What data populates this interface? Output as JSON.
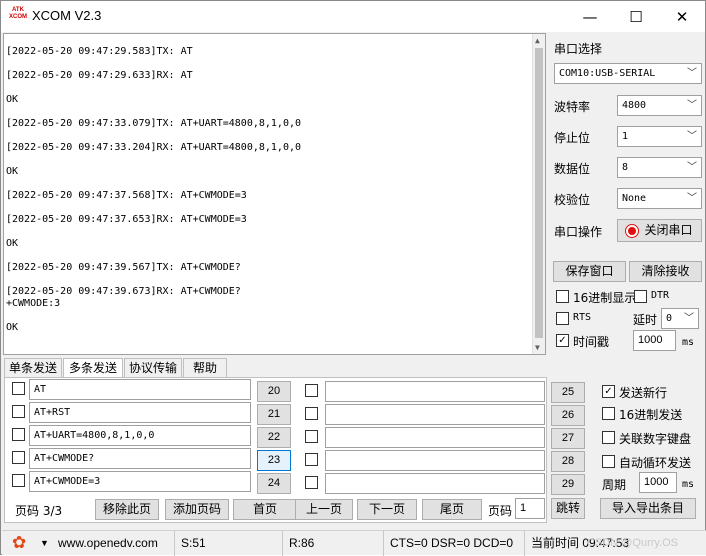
{
  "window": {
    "title": "XCOM V2.3",
    "logo_text": "ATK XCOM",
    "minimize": "—",
    "maximize": "☐",
    "close": "✕"
  },
  "receive": {
    "lines": [
      "[2022-05-20 09:47:29.583]TX: AT",
      "[2022-05-20 09:47:29.633]RX: AT",
      "OK",
      "[2022-05-20 09:47:33.079]TX: AT+UART=4800,8,1,0,0",
      "[2022-05-20 09:47:33.204]RX: AT+UART=4800,8,1,0,0",
      "OK",
      "[2022-05-20 09:47:37.568]TX: AT+CWMODE=3",
      "[2022-05-20 09:47:37.653]RX: AT+CWMODE=3",
      "OK",
      "[2022-05-20 09:47:39.567]TX: AT+CWMODE?",
      "[2022-05-20 09:47:39.673]RX: AT+CWMODE?",
      "+CWMODE:3",
      "OK"
    ]
  },
  "serial": {
    "port_label": "串口选择",
    "port_value": "COM10:USB-SERIAL",
    "baud_label": "波特率",
    "baud_value": "4800",
    "stop_label": "停止位",
    "stop_value": "1",
    "data_label": "数据位",
    "data_value": "8",
    "parity_label": "校验位",
    "parity_value": "None",
    "op_label": "串口操作",
    "op_button": "关闭串口"
  },
  "controls": {
    "save_window": "保存窗口",
    "clear_recv": "清除接收",
    "hex_display": "16进制显示",
    "dtr": "DTR",
    "rts": "RTS",
    "delay_label": "延时",
    "delay_value": "0",
    "timestamp": "时间戳",
    "timestamp_value": "1000",
    "unit_ms": "ms"
  },
  "tabs": [
    "单条发送",
    "多条发送",
    "协议传输",
    "帮助"
  ],
  "multi_send": {
    "left": [
      {
        "text": "AT",
        "num": "20"
      },
      {
        "text": "AT+RST",
        "num": "21"
      },
      {
        "text": "AT+UART=4800,8,1,0,0",
        "num": "22"
      },
      {
        "text": "AT+CWMODE?",
        "num": "23"
      },
      {
        "text": "AT+CWMODE=3",
        "num": "24"
      }
    ],
    "right": [
      {
        "text": "",
        "num": "25"
      },
      {
        "text": "",
        "num": "26"
      },
      {
        "text": "",
        "num": "27"
      },
      {
        "text": "",
        "num": "28"
      },
      {
        "text": "",
        "num": "29"
      }
    ],
    "send_newline": "发送新行",
    "hex_send": "16进制发送",
    "link_keypad": "关联数字键盘",
    "auto_loop": "自动循环发送",
    "period_label": "周期",
    "period_value": "1000",
    "period_unit": "ms"
  },
  "pager": {
    "page_info": "页码 3/3",
    "remove_page": "移除此页",
    "add_page": "添加页码",
    "first": "首页",
    "prev": "上一页",
    "next": "下一页",
    "last": "尾页",
    "page_label": "页码",
    "page_value": "1",
    "jump": "跳转",
    "import_export": "导入导出条目"
  },
  "status": {
    "url": "www.openedv.com",
    "s": "S:51",
    "r": "R:86",
    "lines": "CTS=0 DSR=0 DCD=0",
    "time": "当前时间 09:47:53",
    "watermark": "CSDN @Qurry.OS"
  },
  "colors": {
    "accent_red": "#e01010",
    "focus_blue": "#0078d7"
  }
}
